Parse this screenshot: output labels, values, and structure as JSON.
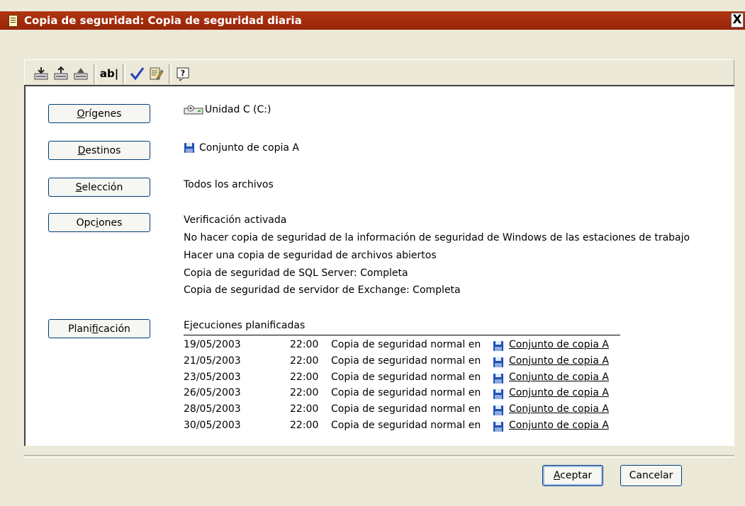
{
  "window": {
    "title": "Copia de seguridad: Copia de seguridad diaria",
    "close_glyph": "X"
  },
  "toolbar": {
    "icons": [
      "backup-job-icon",
      "restore-job-icon",
      "copy-job-icon",
      "rename-icon",
      "verify-icon",
      "properties-icon",
      "help-icon"
    ],
    "rename_label": "ab|",
    "help_label": "?"
  },
  "sections": {
    "origenes": {
      "button": "Orígenes",
      "mnemonic": "O",
      "rest": "rígenes",
      "value": "Unidad C (C:)"
    },
    "destinos": {
      "button": "Destinos",
      "mnemonic": "D",
      "rest": "estinos",
      "value": "Conjunto de copia A"
    },
    "seleccion": {
      "button": "Selección",
      "mnemonic": "S",
      "rest": "elección",
      "value": "Todos los archivos"
    },
    "opciones": {
      "button": "Opciones",
      "pre": "Opc",
      "mnemonic": "i",
      "post": "ones",
      "lines": [
        "Verificación activada",
        "No hacer copia de seguridad de la información de seguridad de Windows de las estaciones de trabajo",
        "Hacer una copia de seguridad de archivos abiertos",
        "Copia de seguridad de SQL Server: Completa",
        "Copia de seguridad de servidor de Exchange: Completa"
      ]
    },
    "planificacion": {
      "button": "Planificación",
      "pre": "Plani",
      "mnemonic": "f",
      "post": "icación",
      "heading": "Ejecuciones planificadas",
      "runs": [
        {
          "date": "19/05/2003",
          "time": "22:00",
          "type": "Copia de seguridad normal en",
          "target": "Conjunto de copia A"
        },
        {
          "date": "21/05/2003",
          "time": "22:00",
          "type": "Copia de seguridad normal en",
          "target": "Conjunto de copia A"
        },
        {
          "date": "23/05/2003",
          "time": "22:00",
          "type": "Copia de seguridad normal en",
          "target": "Conjunto de copia A"
        },
        {
          "date": "26/05/2003",
          "time": "22:00",
          "type": "Copia de seguridad normal en",
          "target": "Conjunto de copia A"
        },
        {
          "date": "28/05/2003",
          "time": "22:00",
          "type": "Copia de seguridad normal en",
          "target": "Conjunto de copia A"
        },
        {
          "date": "30/05/2003",
          "time": "22:00",
          "type": "Copia de seguridad normal en",
          "target": "Conjunto de copia A"
        }
      ]
    }
  },
  "buttons": {
    "aceptar": {
      "mnemonic": "A",
      "rest": "ceptar"
    },
    "cancelar": "Cancelar"
  },
  "colors": {
    "titlebar": "#a42a0c",
    "floppy": "#1f4fb4",
    "check": "#1f3fbf"
  }
}
